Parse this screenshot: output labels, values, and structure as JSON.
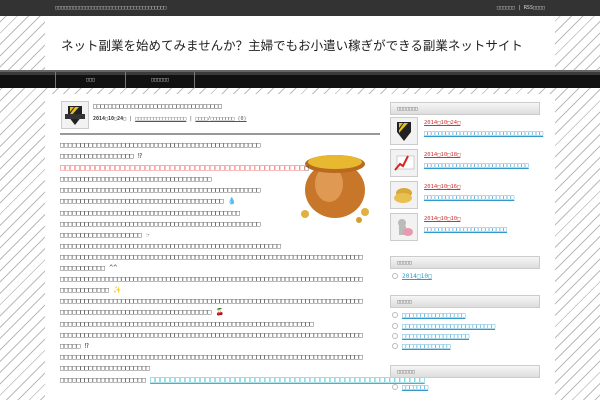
{
  "topbar": {
    "tagline": "□□□□□□□□□□□□□□□□□□□□□□□□□□□□□□□□□□□□□",
    "links": "□□□□□□ | RSS□□□□"
  },
  "header": {
    "site_title": "ネット副業を始めてみませんか？主婦でもお小遣い稼ぎができる副業ネットサイト"
  },
  "nav": {
    "items": [
      "□□□",
      "□□□□□□"
    ]
  },
  "article": {
    "title": "□□□□□□□□□□□□□□□□□□□□□□□□□□□□□□□□□□",
    "date": "2014□10□24□",
    "category": "□□□□□□□□□□□□□□□□□",
    "comments": "□□□□/□□□□□□□□ (0)",
    "lines": [
      "□□□□□□□□□□□□□□□□□□□□□□□□□□□□□□□□□□□□□□□□□□□□□□□□□",
      "□□□□□□□□□□□□□□□□□□ ⁉",
      "□□□□□□□□□□□□□□□□□□□□□□□□□□□□□□□□□□□□□□□□□□□□□□□□□",
      "□□□□□□□□□□□□□□□□□□□□□□□□□□□□□□□□□□□□□",
      "□□□□□□□□□□□□□□□□□□□□□□□□□□□□□□□□□□□□□□□□□□□□□□□□□",
      "□□□□□□□□□□□□□□□□□□□□□□□□□□□□□□□□□□□□□□□□ 💧",
      "□□□□□□□□□□□□□□□□□□□□□□□□□□□□□□□□□□□□□□□□□□□□",
      "□□□□□□□□□□□□□□□□□□□□□□□□□□□□□□□□□□□□□□□□□□□□□□□□□",
      "□□□□□□□□□□□□□□□□□□□□ ☞",
      "□□□□□□□□□□□□□□□□□□□□□□□□□□□□□□□□□□□□□□□□□□□□□□□□□□□□□□",
      "□□□□□□□□□□□□□□□□□□□□□□□□□□□□□□□□□□□□□□□□□□□□□□□□□□□□□□□□□□□□□□□□□□□□□□□□□□",
      "□□□□□□□□□□□ ^^",
      "□□□□□□□□□□□□□□□□□□□□□□□□□□□□□□□□□□□□□□□□□□□□□□□□□□□□□□□□□□□□□□□□□□□□□□□□□□",
      "□□□□□□□□□□□□ ✨",
      "□□□□□□□□□□□□□□□□□□□□□□□□□□□□□□□□□□□□□□□□□□□□□□□□□□□□□□□□□□□□□□□□□□□□□□□□□□",
      "□□□□□□□□□□□□□□□□□□□□□□□□□□□□□□□□□□□□□ 🍒",
      "□□□□□□□□□□□□□□□□□□□□□□□□□□□□□□□□□□□□□□□□□□□□□□□□□□□□□□□□□□□□□□",
      "□□□□□□□□□□□□□□□□□□□□□□□□□□□□□□□□□□□□□□□□□□□□□□□□□□□□□□□□□□□□□□□□□□□□□□□□□□",
      "□□□□□ ⁉",
      "□□□□□□□□□□□□□□□□□□□□□□□□□□□□□□□□□□□□□□□□□□□□□□□□□□□□□□□□□□□□□□□□□□□□□□□□□□",
      "□□□□□□□□□□□□□□□□□□□□□□"
    ],
    "red_suffix": "□",
    "last_line": "□□□□□□□□□□□□□□□□□□□□□",
    "last_link": "□□□□□□□□□□□□□□□□□□□□□□□□□□□□□□□□□□□□□□□□□□□□□□□□□□□□□□□"
  },
  "sidebar": {
    "recent_heading": "□□□□□□□",
    "recent": [
      {
        "date": "2014□10□24□",
        "title": "□□□□□□□□□□□□□□□□□□□□□□□□□□□□□□□□□"
      },
      {
        "date": "2014□10□18□",
        "title": "□□□□□□□□□□□□□□□□□□□□□□□□□□□□□"
      },
      {
        "date": "2014□10□16□",
        "title": "□□□□□□□□□□□□□□□□□□□□□□□□□"
      },
      {
        "date": "2014□10□10□",
        "title": "□□□□□□□□□□□□□□□□□□□□□□□"
      }
    ],
    "archive_heading": "□□□□□",
    "archives": [
      "2014□10□"
    ],
    "category_heading": "□□□□□",
    "categories": [
      "□□□□□□□□□□□□□□□□□",
      "□□□□□□□□□□□□□□□□□□□□□□□□□",
      "□□□□□□□□□□□□□□□□□□",
      "□□□□□□□□□□□□□"
    ],
    "other_heading": "□□□□□□",
    "others": [
      "□□□□□□□"
    ]
  }
}
